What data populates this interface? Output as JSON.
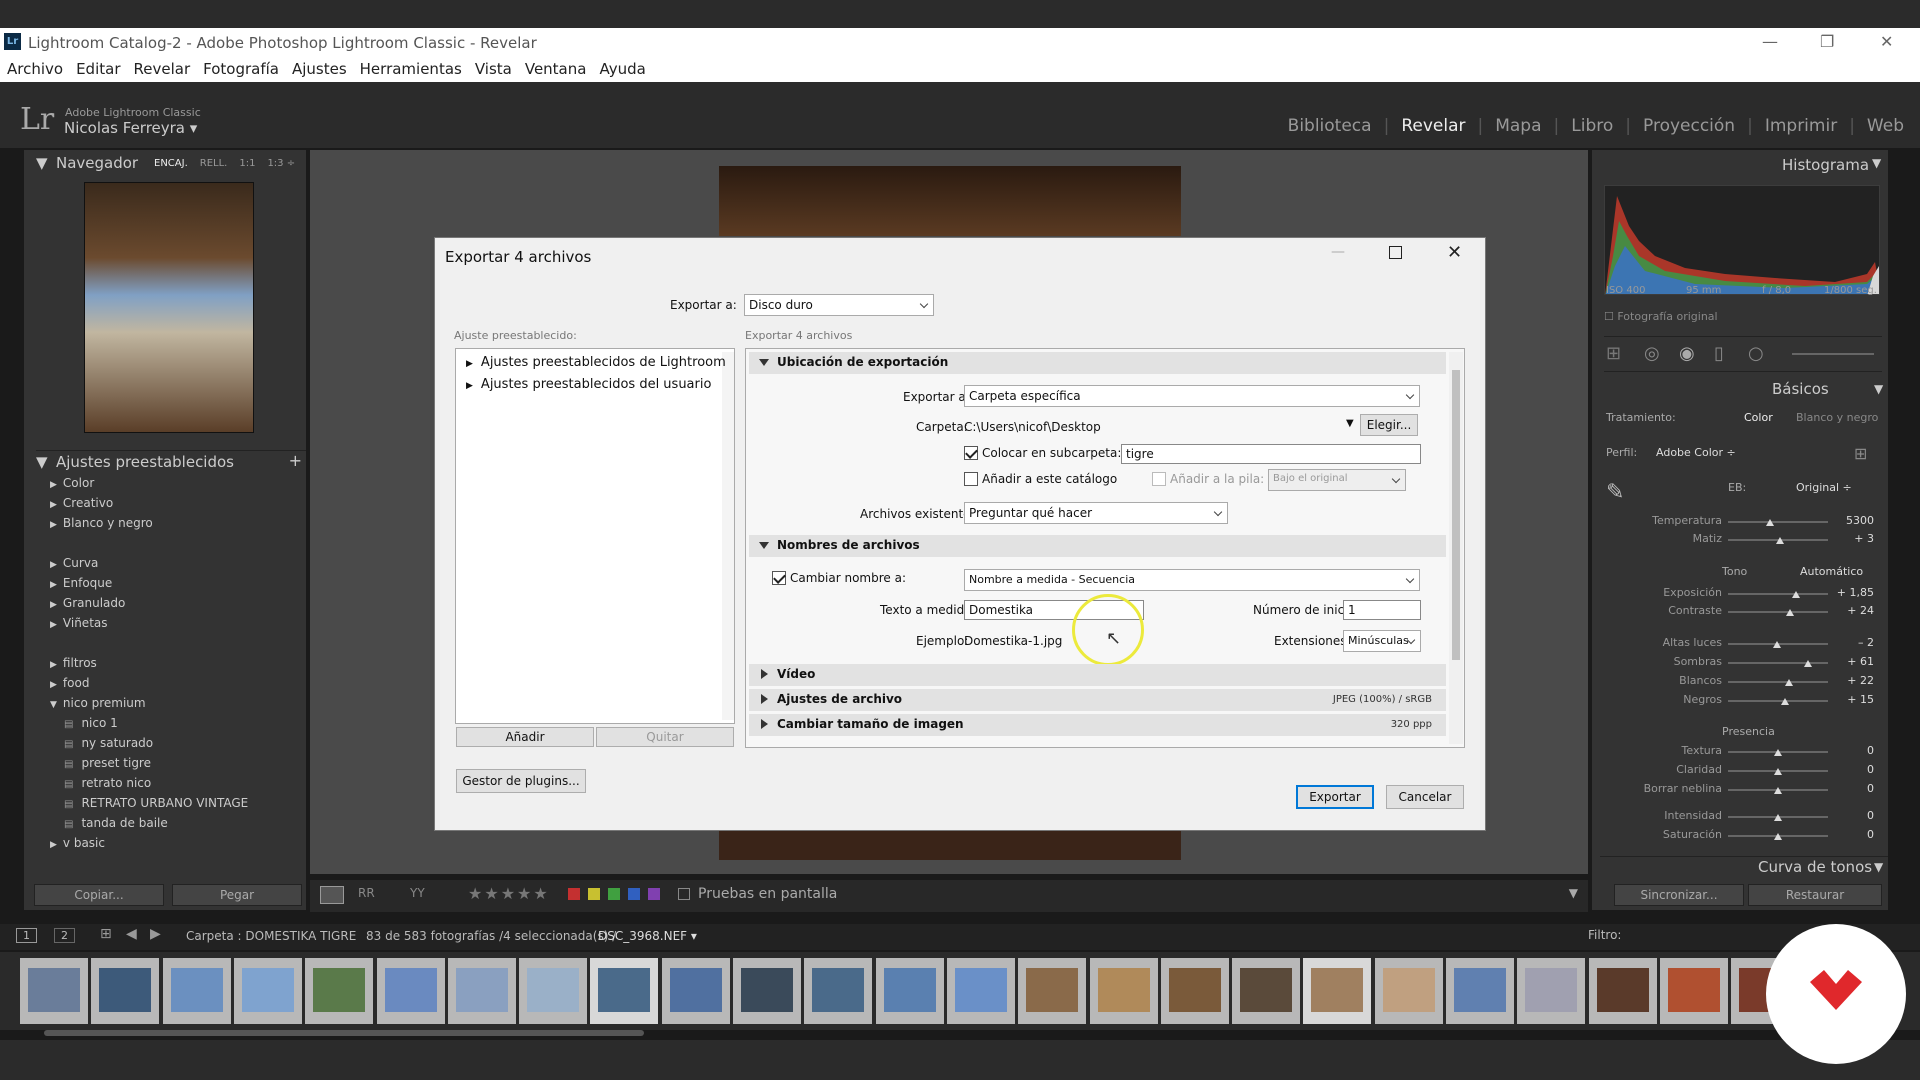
{
  "window": {
    "title": "Lightroom Catalog-2 - Adobe Photoshop Lightroom Classic - Revelar",
    "icon": "Lr"
  },
  "menu": [
    "Archivo",
    "Editar",
    "Revelar",
    "Fotografía",
    "Ajustes",
    "Herramientas",
    "Vista",
    "Ventana",
    "Ayuda"
  ],
  "identity": {
    "product": "Adobe Lightroom Classic",
    "user": "Nicolas Ferreyra ▾",
    "logo": "Lr"
  },
  "modules": [
    "Biblioteca",
    "Revelar",
    "Mapa",
    "Libro",
    "Proyección",
    "Imprimir",
    "Web"
  ],
  "navigator": {
    "title": "Navegador",
    "zooms": [
      "ENCAJ.",
      "RELL.",
      "1:1",
      "1:3 ÷"
    ]
  },
  "presets": {
    "title": "Ajustes preestablecidos",
    "groups": [
      "Color",
      "Creativo",
      "Blanco y negro",
      "Curva",
      "Enfoque",
      "Granulado",
      "Viñetas",
      "filtros",
      "food",
      "nico premium"
    ],
    "nico_items": [
      "nico 1",
      "ny saturado",
      "preset tigre",
      "retrato nico",
      "RETRATO URBANO VINTAGE",
      "tanda de baile"
    ],
    "last": "v basic"
  },
  "left_buttons": {
    "copy": "Copiar...",
    "paste": "Pegar"
  },
  "histogram": {
    "title": "Histograma",
    "iso": "ISO 400",
    "focal": "95 mm",
    "aperture": "f / 8,0",
    "shutter": "1/800 seg.",
    "original": "Fotografía original"
  },
  "basic": {
    "title": "Básicos",
    "treatment": "Tratamiento:",
    "color": "Color",
    "bw": "Blanco y negro",
    "profile_label": "Perfil:",
    "profile": "Adobe Color ÷",
    "wb_label": "EB:",
    "wb": "Original ÷",
    "tone": "Tono",
    "auto": "Automático",
    "presence": "Presencia",
    "curve": "Curva de tonos",
    "sliders": [
      {
        "label": "Temperatura",
        "value": "5300",
        "pos": 0.42
      },
      {
        "label": "Matiz",
        "value": "+ 3",
        "pos": 0.52
      },
      {
        "label": "Exposición",
        "value": "+ 1,85",
        "pos": 0.68
      },
      {
        "label": "Contraste",
        "value": "+ 24",
        "pos": 0.62
      },
      {
        "label": "Altas luces",
        "value": "– 2",
        "pos": 0.49
      },
      {
        "label": "Sombras",
        "value": "+ 61",
        "pos": 0.8
      },
      {
        "label": "Blancos",
        "value": "+ 22",
        "pos": 0.61
      },
      {
        "label": "Negros",
        "value": "+ 15",
        "pos": 0.57
      },
      {
        "label": "Textura",
        "value": "0",
        "pos": 0.5
      },
      {
        "label": "Claridad",
        "value": "0",
        "pos": 0.5
      },
      {
        "label": "Borrar neblina",
        "value": "0",
        "pos": 0.5
      },
      {
        "label": "Intensidad",
        "value": "0",
        "pos": 0.5
      },
      {
        "label": "Saturación",
        "value": "0",
        "pos": 0.5
      }
    ]
  },
  "right_buttons": {
    "sync": "Sincronizar...",
    "reset": "Restaurar"
  },
  "toolbar": {
    "proof": "Pruebas en pantalla",
    "stars": "★★★★★"
  },
  "filmstrip": {
    "screen1": "1",
    "screen2": "2",
    "folder": "Carpeta : DOMESTIKA TIGRE",
    "count": "83 de 583 fotografías /4 seleccionada(s) /",
    "file": "DSC_3968.NEF ▾",
    "filter": "Filtro:"
  },
  "dialog": {
    "title": "Exportar 4 archivos",
    "export_to_label": "Exportar a:",
    "export_to": "Disco duro",
    "preset_label": "Ajuste preestablecido:",
    "preset_tree": [
      "Ajustes preestablecidos de Lightroom",
      "Ajustes preestablecidos del usuario"
    ],
    "add": "Añadir",
    "remove": "Quitar",
    "plugins": "Gestor de plugins...",
    "right_header": "Exportar 4 archivos",
    "location": {
      "title": "Ubicación de exportación",
      "export_to_label": "Exportar a:",
      "export_to": "Carpeta específica",
      "folder_label": "Carpeta:",
      "folder": "C:\\Users\\nicof\\Desktop",
      "choose": "Elegir...",
      "subfolder_label": "Colocar en subcarpeta:",
      "subfolder": "tigre",
      "add_catalog": "Añadir a este catálogo",
      "add_stack": "Añadir a la pila:",
      "stack_pos": "Bajo el original",
      "existing_label": "Archivos existentes:",
      "existing": "Preguntar qué hacer"
    },
    "naming": {
      "title": "Nombres de archivos",
      "rename_label": "Cambiar nombre a:",
      "rename": "Nombre a medida - Secuencia",
      "custom_label": "Texto a medida:",
      "custom": "Domestika",
      "start_label": "Número de inicio:",
      "start": "1",
      "example_label": "Ejemplo:",
      "example": "Domestika-1.jpg",
      "ext_label": "Extensiones:",
      "ext": "Minúsculas"
    },
    "video": "Vídeo",
    "filesettings": {
      "title": "Ajustes de archivo",
      "info": "JPEG (100%) / sRGB"
    },
    "resize": {
      "title": "Cambiar tamaño de imagen",
      "info": "320 ppp"
    },
    "export_btn": "Exportar",
    "cancel_btn": "Cancelar"
  },
  "colors": {
    "accent": "#0078d7",
    "lr_bg": "#333333",
    "brand_red": "#e0282c"
  }
}
